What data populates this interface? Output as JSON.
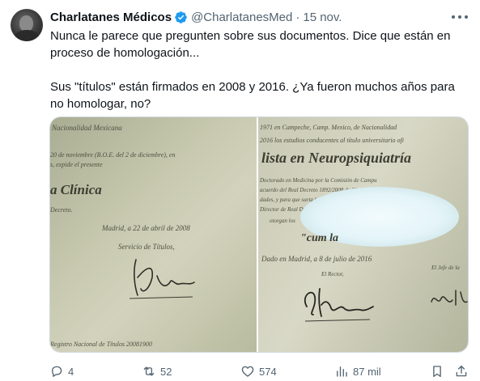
{
  "tweet": {
    "author_name": "Charlatanes Médicos",
    "author_handle": "@CharlatanesMed",
    "separator": "·",
    "date": "15 nov.",
    "text_lines": [
      "Nunca le parece que pregunten sobre sus documentos. Dice que están en",
      "proceso de homologación...",
      "Sus \"títulos\" están firmados en 2008 y 2016. ¿Ya fueron muchos años para",
      "no homologar, no?"
    ]
  },
  "media": {
    "photo1_texts": [
      "Nacionalidad Mexicana",
      "20 de noviembre (B.O.E. del 2 de diciembre), en",
      "s, expide el presente",
      "a Clínica",
      "Decreto.",
      "Madrid, a 22 de abril de 2008",
      "Servicio de Títulos,",
      "Registro Nacional de Títulos 20081900"
    ],
    "photo2_texts": [
      "1971 en Campeche, Camp. Mexico, de Nacionalidad",
      "2016 los estudios conducentes al título universitario ofi",
      "lista en Neuropsiquiatría",
      "Doctorado en Medicina por la Comisión de Campu",
      "acuerdo del Real Decreto 1892/2008 de 21 de julio, 2011",
      "dades, y para que surta los efectos que le corresponde",
      "Director de Real Decreto, y por la documentación",
      "otorgan los",
      "\"cum la",
      "Dado en Madrid, a 8 de julio de 2016",
      "El Rector,",
      "El Jefe de la"
    ]
  },
  "actions": {
    "replies": "4",
    "retweets": "52",
    "likes": "574",
    "views": "87 mil"
  },
  "colors": {
    "text": "#0f1419",
    "secondary": "#536471",
    "verified": "#1d9bf0"
  },
  "icons": {
    "verified": "verified-badge-icon",
    "more": "more-icon",
    "reply": "reply-icon",
    "retweet": "retweet-icon",
    "like": "heart-icon",
    "views": "views-icon",
    "bookmark": "bookmark-icon",
    "share": "share-icon"
  }
}
